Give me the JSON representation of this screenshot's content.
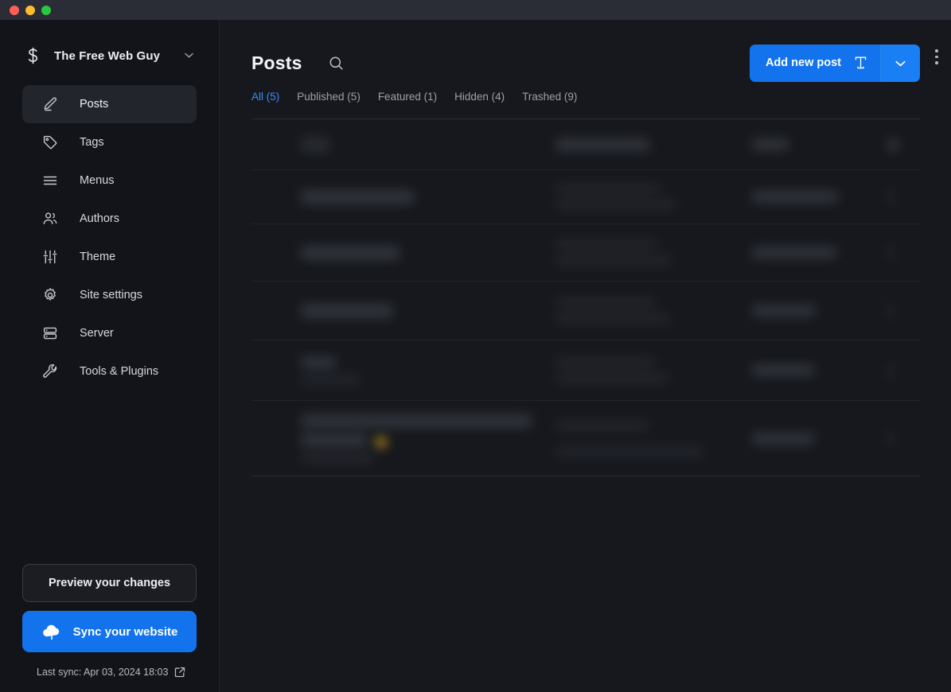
{
  "window": {
    "traffic_lights": [
      "close",
      "minimize",
      "maximize"
    ],
    "titlebar_color": "#2b2d36"
  },
  "theme": {
    "background": "#16181d",
    "sidebar_background": "#131419",
    "accent": "#1273ed",
    "active_tab_color": "#3b8ef5",
    "text_primary": "#eceef2",
    "text_secondary": "#9ba0ab"
  },
  "sidebar": {
    "site": {
      "logo_icon": "dollar-sign-icon",
      "name": "The Free Web Guy",
      "caret_icon": "chevron-down-icon"
    },
    "items": [
      {
        "label": "Posts",
        "icon": "pencil-icon",
        "active": true
      },
      {
        "label": "Tags",
        "icon": "tag-icon",
        "active": false
      },
      {
        "label": "Menus",
        "icon": "menu-icon",
        "active": false
      },
      {
        "label": "Authors",
        "icon": "users-icon",
        "active": false
      },
      {
        "label": "Theme",
        "icon": "sliders-icon",
        "active": false
      },
      {
        "label": "Site settings",
        "icon": "gear-icon",
        "active": false
      },
      {
        "label": "Server",
        "icon": "server-icon",
        "active": false
      },
      {
        "label": "Tools & Plugins",
        "icon": "wrench-icon",
        "active": false
      }
    ],
    "footer": {
      "preview_label": "Preview your changes",
      "sync_label": "Sync your website",
      "sync_icon": "cloud-upload-icon",
      "last_sync_label": "Last sync: Apr 03, 2024 18:03",
      "external_link_icon": "external-link-icon"
    }
  },
  "main": {
    "title": "Posts",
    "search_icon": "search-icon",
    "kebab_icon": "more-vertical-icon",
    "add_post": {
      "label": "Add new post",
      "type_icon": "text-type-icon",
      "dropdown_icon": "chevron-down-icon"
    },
    "tabs": [
      {
        "label": "All (5)",
        "active": true
      },
      {
        "label": "Published (5)",
        "active": false
      },
      {
        "label": "Featured (1)",
        "active": false
      },
      {
        "label": "Hidden (4)",
        "active": false
      },
      {
        "label": "Trashed (9)",
        "active": false
      }
    ],
    "table": {
      "note": "Post list content is visually redacted (blurred) in the screenshot",
      "rows": [
        {
          "title_redacted": true,
          "meta_redacted": true,
          "date_redacted": true,
          "more_redacted": true
        },
        {
          "title_redacted": true,
          "meta_redacted": true,
          "date_redacted": true,
          "more_redacted": true
        },
        {
          "title_redacted": true,
          "meta_redacted": true,
          "date_redacted": true,
          "more_redacted": true
        },
        {
          "title_redacted": true,
          "meta_redacted": true,
          "date_redacted": true,
          "more_redacted": true
        },
        {
          "title_redacted": true,
          "meta_redacted": true,
          "date_redacted": true,
          "more_redacted": true
        },
        {
          "title_redacted": true,
          "meta_redacted": true,
          "date_redacted": true,
          "more_redacted": true
        }
      ]
    }
  }
}
